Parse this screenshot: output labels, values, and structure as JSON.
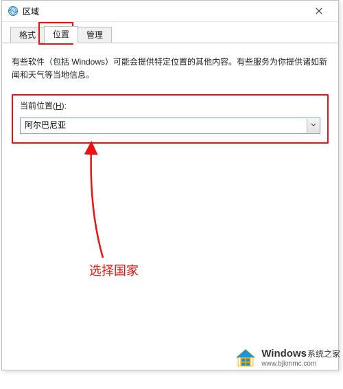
{
  "dialog": {
    "title": "区域"
  },
  "tabs": {
    "format": "格式",
    "location": "位置",
    "admin": "管理"
  },
  "content": {
    "description": "有些软件（包括 Windows）可能会提供特定位置的其他内容。有些服务为你提供诸如新闻和天气等当地信息。",
    "location_label_prefix": "当前位置(",
    "location_label_key": "H",
    "location_label_suffix": "):",
    "selected_country": "阿尔巴尼亚"
  },
  "annotation": {
    "text": "选择国家"
  },
  "watermark": {
    "brand": "Windows",
    "brand_cn": "系统之家",
    "url": "www.bjkmmc.com"
  }
}
